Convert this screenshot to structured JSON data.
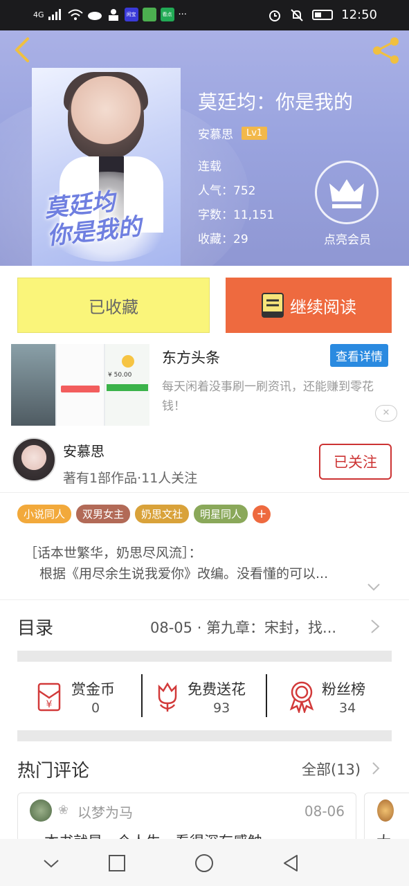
{
  "status_bar": {
    "signal": "4G",
    "apps": [
      {
        "icon": "taobao-app-icon",
        "label": "闲宝",
        "color": "#3a3ad8"
      },
      {
        "icon": "green-app-icon",
        "label": "",
        "color": "#4caf50"
      },
      {
        "icon": "kankan-app-icon",
        "label": "看点",
        "color": "#22aa55"
      }
    ],
    "more": "···",
    "time": "12:50"
  },
  "header": {
    "title": "莫廷均：你是我的",
    "author": "安慕思",
    "level": "Lv1",
    "status": "连载",
    "popularity": "人气：752",
    "word_count": "字数：11,151",
    "favorites": "收藏：29",
    "vip_label": "点亮会员",
    "cover_text": "莫廷均\n你是我的"
  },
  "actions": {
    "favorited_label": "已收藏",
    "continue_label": "继续阅读"
  },
  "ad": {
    "title": "东方头条",
    "detail_label": "查看详情",
    "desc": "每天闲着没事刷一刷资讯，还能赚到零花钱！",
    "thumb_money": "¥ 50.00",
    "close": "✕"
  },
  "author_card": {
    "name": "安慕思",
    "sub": "著有1部作品·11人关注",
    "follow_label": "已关注"
  },
  "tags": [
    {
      "label": "小说同人",
      "color": "#f2a93b"
    },
    {
      "label": "双男女主",
      "color": "#b26a57"
    },
    {
      "label": "奶思文社",
      "color": "#d9a23a"
    },
    {
      "label": "明星同人",
      "color": "#8aa85a"
    }
  ],
  "tag_add": "+",
  "description": {
    "line1": "［话本世繁华，奶思尽风流］：",
    "line2": "根据《用尽余生说我爱你》改编。没看懂的可以..."
  },
  "catalog": {
    "label": "目录",
    "latest": "08-05 · 第九章：宋封，找..."
  },
  "stats": [
    {
      "label": "赏金币",
      "value": "0",
      "icon": "red-envelope-icon"
    },
    {
      "label": "免费送花",
      "value": "93",
      "icon": "flower-icon"
    },
    {
      "label": "粉丝榜",
      "value": "34",
      "icon": "medal-icon"
    }
  ],
  "hot_comments": {
    "title": "热门评论",
    "all_label": "全部(13)",
    "items": [
      {
        "user": "以梦为马",
        "date": "08-06",
        "text": "一本书就是一个人生，看得深有感触"
      },
      {
        "user": "",
        "date": "",
        "text": "大"
      }
    ]
  },
  "colors": {
    "accent_orange": "#ee6a3f",
    "fav_yellow": "#faf57a",
    "follow_red": "#cc3333",
    "ad_blue": "#2a8ae0"
  }
}
